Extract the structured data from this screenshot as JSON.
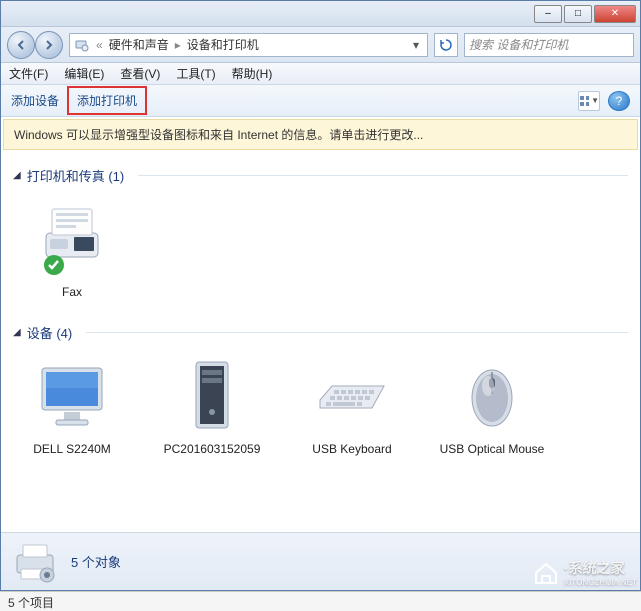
{
  "titlebar": {
    "min": "–",
    "max": "□",
    "close": "✕"
  },
  "nav": {
    "crumb1": "硬件和声音",
    "crumb2": "设备和打印机",
    "search_placeholder": "搜索 设备和打印机"
  },
  "menu": {
    "file": "文件(F)",
    "edit": "编辑(E)",
    "view": "查看(V)",
    "tools": "工具(T)",
    "help": "帮助(H)"
  },
  "toolbar": {
    "add_device": "添加设备",
    "add_printer": "添加打印机"
  },
  "infobar": {
    "text": "Windows 可以显示增强型设备图标和来自 Internet 的信息。请单击进行更改..."
  },
  "groups": {
    "printers": {
      "title": "打印机和传真 (1)"
    },
    "devices": {
      "title": "设备 (4)"
    }
  },
  "items": {
    "fax": "Fax",
    "monitor": "DELL S2240M",
    "pc": "PC201603152059",
    "keyboard": "USB Keyboard",
    "mouse": "USB Optical Mouse"
  },
  "statusbar": {
    "count": "5 个对象"
  },
  "bottom": {
    "text": "5 个项目"
  },
  "watermark": {
    "text": "·系统之家",
    "sub": "XITONGZHIJIA.NET"
  }
}
